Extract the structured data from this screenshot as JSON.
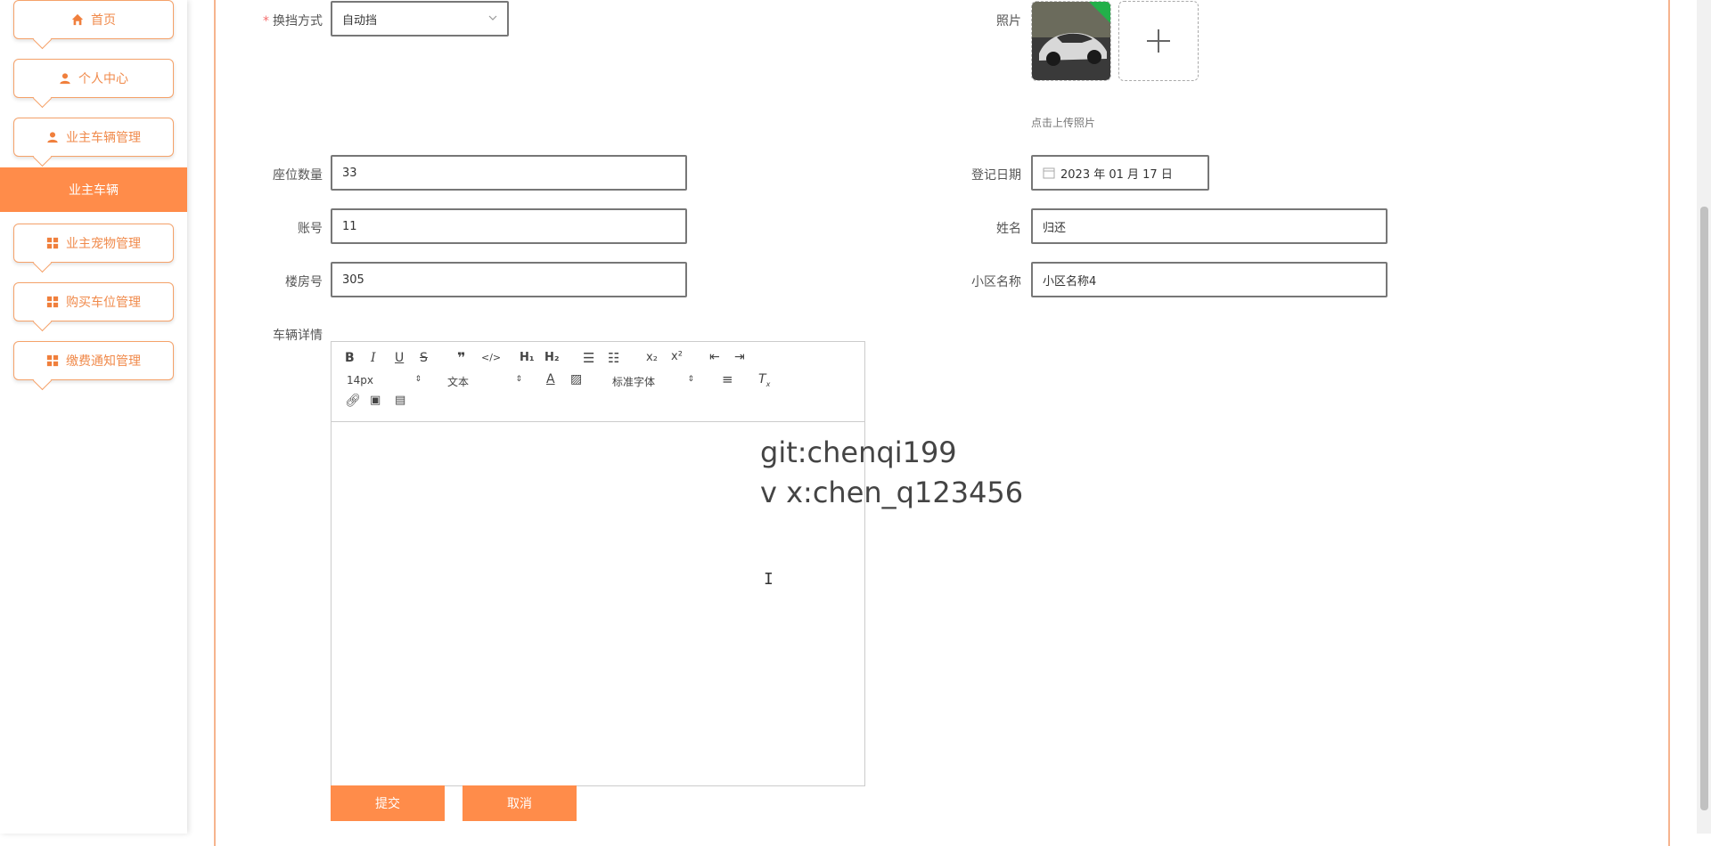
{
  "sidebar": {
    "items": [
      {
        "label": "首页",
        "icon": "home-icon"
      },
      {
        "label": "个人中心",
        "icon": "user-icon"
      },
      {
        "label": "业主车辆管理",
        "icon": "user-icon"
      },
      {
        "label": "业主宠物管理",
        "icon": "grid-icon"
      },
      {
        "label": "购买车位管理",
        "icon": "grid-icon"
      },
      {
        "label": "缴费通知管理",
        "icon": "grid-icon"
      }
    ],
    "active_submenu": "业主车辆",
    "accent_color": "#ff8c4a"
  },
  "form": {
    "gear_label": "换挡方式",
    "gear_value": "自动挡",
    "photo_label": "照片",
    "upload_hint": "点击上传照片",
    "seats_label": "座位数量",
    "seats_value": "33",
    "reg_date_label": "登记日期",
    "reg_date_value": "2023 年 01 月 17 日",
    "account_label": "账号",
    "account_value": "11",
    "name_label": "姓名",
    "name_value": "归还",
    "room_label": "楼房号",
    "room_value": "305",
    "community_label": "小区名称",
    "community_value": "小区名称4",
    "details_label": "车辆详情"
  },
  "editor": {
    "font_size": "14px",
    "text_type": "文本",
    "font_family": "标准字体"
  },
  "watermark": {
    "line1": "git:chenqi199",
    "line2": "v x:chen_q123456"
  },
  "buttons": {
    "submit": "提交",
    "cancel": "取消"
  }
}
